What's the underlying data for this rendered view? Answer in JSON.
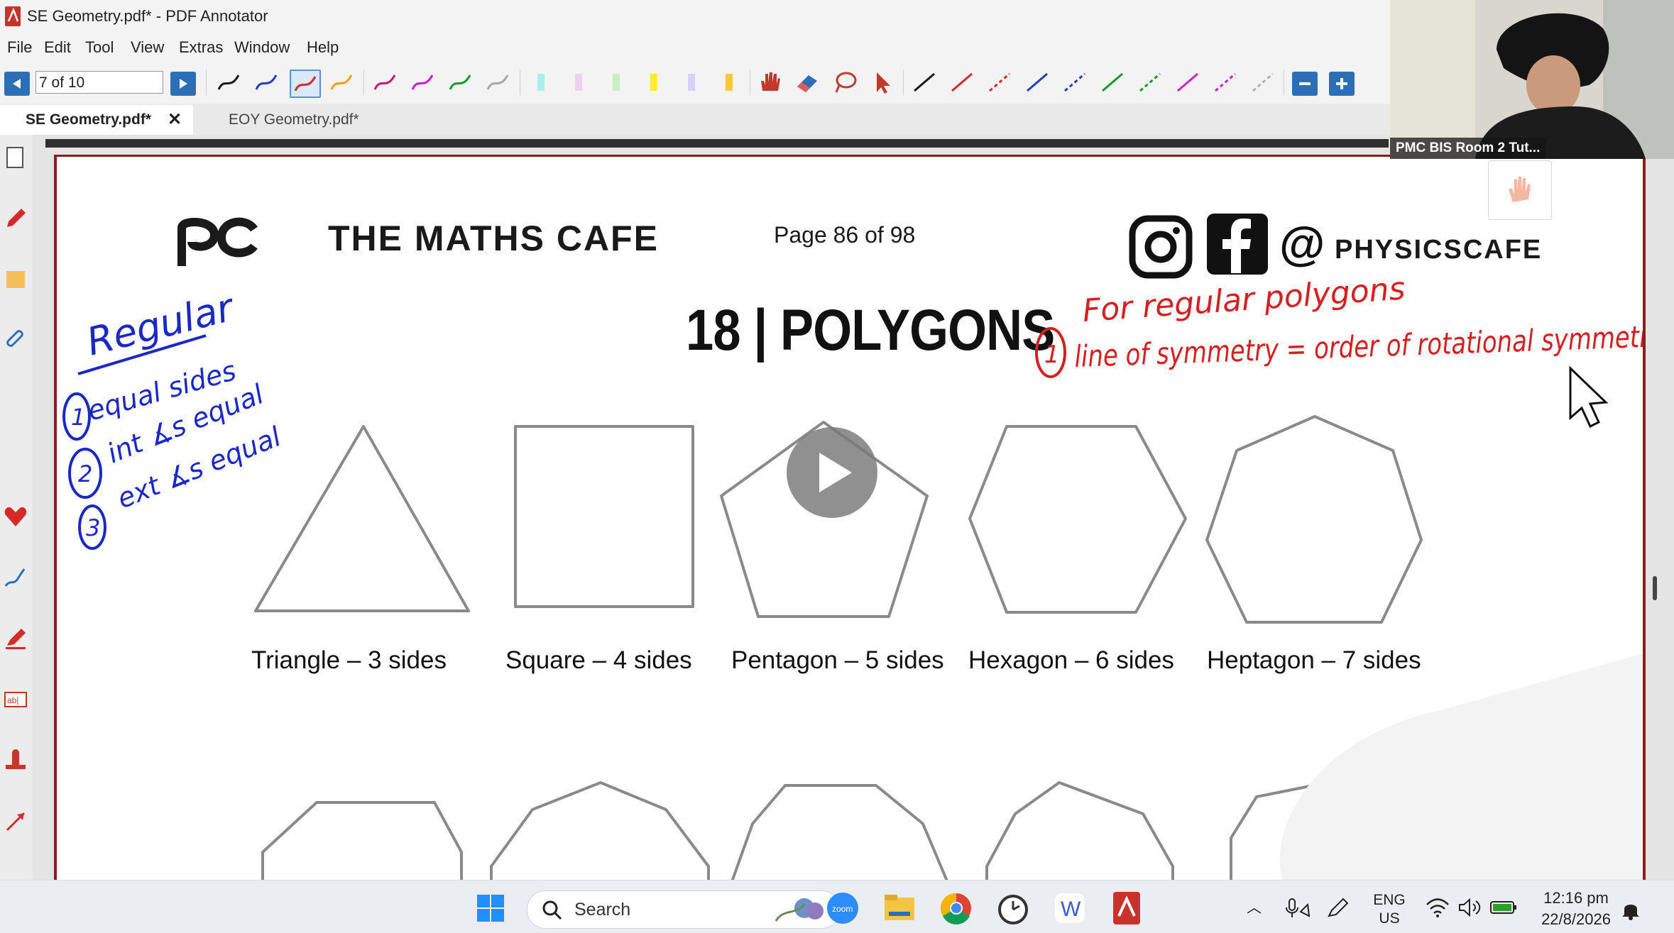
{
  "window": {
    "title": "SE Geometry.pdf* - PDF Annotator"
  },
  "menu": {
    "items": [
      "File",
      "Edit",
      "Tool",
      "View",
      "Extras",
      "Window",
      "Help"
    ]
  },
  "toolbar": {
    "page_field_value": "7 of 10",
    "pen_colors": [
      "#1a1a1a",
      "#1f3fc9",
      "#d42a2a",
      "#f0a010",
      "#c8186f",
      "#c41fd0",
      "#1a9a2a",
      "#a8a8a8"
    ],
    "highlighter_colors": [
      "#a8f0f0",
      "#f0d0f0",
      "#c8f0c0",
      "#ffee30",
      "#d8d0f8",
      "#ffc830"
    ],
    "line_colors": [
      "#1a1a1a",
      "#d42a2a",
      "#d42a2a",
      "#1f3fc9",
      "#1f3fc9",
      "#1a9a2a",
      "#1a9a2a",
      "#d020d0",
      "#d020d0",
      "#b0b0b0"
    ]
  },
  "tabs": [
    {
      "label": "SE Geometry.pdf*",
      "active": true,
      "close": "✕"
    },
    {
      "label": "EOY Geometry.pdf*",
      "active": false
    }
  ],
  "document": {
    "brand": "THE MATHS CAFE",
    "page_indicator": "Page 86 of 98",
    "social_handle": "PHYSICSCAFE",
    "at_sign": "@",
    "section_title": "18 | POLYGONS",
    "shapes": [
      {
        "label": "Triangle – 3 sides"
      },
      {
        "label": "Square – 4 sides"
      },
      {
        "label": "Pentagon – 5 sides"
      },
      {
        "label": "Hexagon – 6 sides"
      },
      {
        "label": "Heptagon – 7 sides"
      }
    ],
    "annotations": {
      "blue_heading": "Regular",
      "blue_items": [
        "equal sides",
        "int ∡s equal",
        "ext ∡s equal"
      ],
      "blue_numbers": [
        "1",
        "2",
        "3"
      ],
      "red_heading": "For regular polygons",
      "red_number": "1",
      "red_line": "line of symmetry = order of rotational symmetry"
    }
  },
  "video": {
    "participant_name": "PMC BIS Room 2 Tut..."
  },
  "taskbar": {
    "search_placeholder": "Search",
    "language_top": "ENG",
    "language_bottom": "US",
    "time": "12:16 pm",
    "date": "22/8/2026"
  }
}
